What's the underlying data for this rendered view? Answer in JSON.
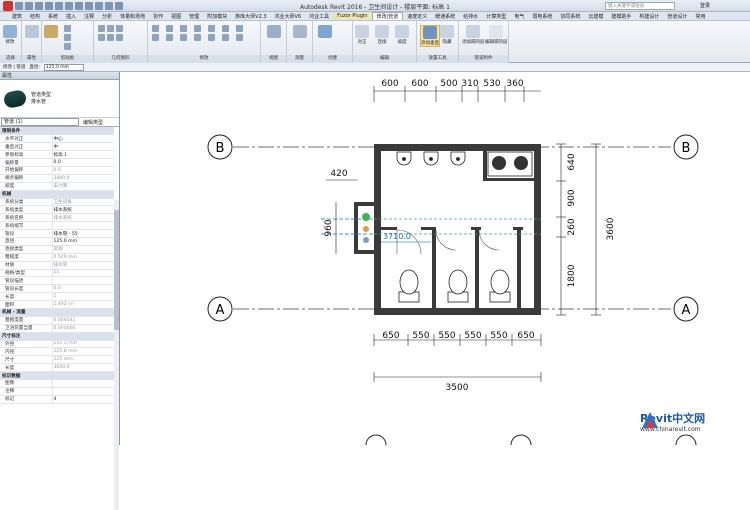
{
  "window": {
    "title": "Autodesk Revit 2016 -     卫生间设计 - 楼层平面: 标高 1",
    "search_placeholder": "键入关键字或短语",
    "login": "登录"
  },
  "menu": [
    "建筑",
    "结构",
    "系统",
    "插入",
    "注释",
    "分析",
    "体量和场地",
    "协作",
    "视图",
    "管理",
    "附加模块",
    "族库大师V2.3",
    "鸿业大师V6",
    "鸿业工具",
    "Fuzor Plugin",
    "修改|管道",
    "速度定义",
    "暖通系统",
    "给排水",
    "计算类型",
    "电气",
    "弱电系统",
    "协同系统",
    "云建模",
    "建模助手",
    "构建设计",
    "管道设计",
    "常用"
  ],
  "ribbon": {
    "modify": "修改",
    "select": "选择",
    "properties": "属性",
    "clipboard": "剪贴板",
    "geometry": "几何图形",
    "modify_group": "修改",
    "view": "视图",
    "measure": "测量",
    "create": "创建",
    "edit": "编辑",
    "placement": "放置工具",
    "pipe_fitting": "管道附件",
    "justify_label": "对正",
    "connect_label": "连接",
    "slope_label": "坡度",
    "add_vertical": "添加垂直",
    "hide_label": "隐藏",
    "connect_insulation": "管道开放端点",
    "add_slope": "添加隔热层",
    "edit_slope": "编辑隔热层"
  },
  "options_bar": {
    "modify_label": "修改 | 管道",
    "diameter_label": "直径:",
    "diameter_value": "125.0 mm"
  },
  "properties": {
    "title": "属性",
    "family": "管道类型",
    "type": "排水管",
    "filter": "管道 (1)",
    "edit_type": "编辑类型",
    "rows": [
      {
        "section": "限制条件"
      },
      {
        "k": "水平对正",
        "v": "中心"
      },
      {
        "k": "垂直对正",
        "v": "中"
      },
      {
        "k": "参照标高",
        "v": "标高 1"
      },
      {
        "k": "偏移量",
        "v": "0.0"
      },
      {
        "k": "开始偏移",
        "v": "0.0",
        "grey": true
      },
      {
        "k": "端点偏移",
        "v": "3800.0",
        "grey": true
      },
      {
        "k": "坡度",
        "v": "未计算",
        "grey": true
      },
      {
        "section": "机械"
      },
      {
        "k": "系统分类",
        "v": "卫生设备",
        "grey": true
      },
      {
        "k": "系统类型",
        "v": "排水系统"
      },
      {
        "k": "系统名称",
        "v": "排水系统",
        "grey": true
      },
      {
        "k": "系统缩写",
        "v": "",
        "grey": true
      },
      {
        "k": "管段",
        "v": "排水管 - 55"
      },
      {
        "k": "直径",
        "v": "125.0 mm"
      },
      {
        "k": "连接类型",
        "v": "常规",
        "grey": true
      },
      {
        "k": "粗糙度",
        "v": "0.549 mm",
        "grey": true
      },
      {
        "k": "材质",
        "v": "排水管",
        "grey": true
      },
      {
        "k": "规格/类型",
        "v": "55",
        "grey": true
      },
      {
        "k": "管段描述",
        "v": "",
        "grey": true
      },
      {
        "k": "管段长度",
        "v": "0.0",
        "grey": true
      },
      {
        "k": "长度",
        "v": "1",
        "grey": true
      },
      {
        "k": "面积",
        "v": "1.492 m²",
        "grey": true
      },
      {
        "section": "机械 - 流量"
      },
      {
        "k": "粗糙度量",
        "v": "0.004041",
        "grey": true
      },
      {
        "k": "卫浴装置当量",
        "v": "0.000000",
        "grey": true
      },
      {
        "section": "尺寸标注"
      },
      {
        "k": "外径",
        "v": "141.3 mm",
        "grey": true
      },
      {
        "k": "内径",
        "v": "125.8 mm",
        "grey": true
      },
      {
        "k": "尺寸",
        "v": "125 mm",
        "grey": true
      },
      {
        "k": "长度",
        "v": "3600.0",
        "grey": true
      },
      {
        "section": "标识数据"
      },
      {
        "k": "图像",
        "v": ""
      },
      {
        "k": "注释",
        "v": ""
      },
      {
        "k": "标记",
        "v": "4"
      }
    ]
  },
  "drawing": {
    "grid_b": "B",
    "grid_a": "A",
    "top_dims": [
      "600",
      "600",
      "500",
      "310",
      "530",
      "360"
    ],
    "right_dims": [
      "640",
      "900",
      "260",
      "1800"
    ],
    "right_total": "3600",
    "left_dims": [
      "420",
      "960"
    ],
    "bottom_dims": [
      "650",
      "550",
      "550",
      "550",
      "550",
      "650"
    ],
    "bottom_total": "3500",
    "pipe_dim": "3710.0"
  },
  "watermark": {
    "brand": "Revit中文网",
    "url": "www.chinarevit.com"
  }
}
